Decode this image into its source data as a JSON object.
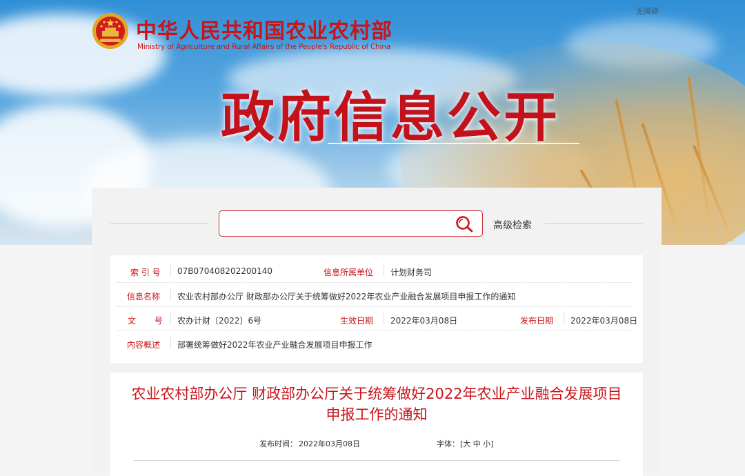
{
  "header": {
    "site_title_cn": "中华人民共和国农业农村部",
    "site_title_en": "Ministry of Agriculture and Rural Affairs of the People's Republic of China",
    "accessibility_label": "无障碍",
    "hero_title": "政府信息公开",
    "brand_red": "#c8141b"
  },
  "search": {
    "placeholder": "",
    "value": "",
    "advanced_label": "高级检索"
  },
  "info": {
    "index_label": "索 引 号",
    "index_value": "07B070408202200140",
    "unit_label": "信息所属单位",
    "unit_value": "计划财务司",
    "name_label": "信息名称",
    "name_value": "农业农村部办公厅 财政部办公厅关于统筹做好2022年农业产业融合发展项目申报工作的通知",
    "doc_label": "文       号",
    "doc_value": "农办计财〔2022〕6号",
    "effective_label": "生效日期",
    "effective_value": "2022年03月08日",
    "publish_label": "发布日期",
    "publish_value": "2022年03月08日",
    "summary_label": "内容概述",
    "summary_value": "部署统筹做好2022年农业产业融合发展项目申报工作"
  },
  "article": {
    "title": "农业农村部办公厅 财政部办公厅关于统筹做好2022年农业产业融合发展项目申报工作的通知",
    "publish_time_label": "发布时间：",
    "publish_time_value": "2022年03月08日",
    "font_size_label": "字体：",
    "font_size_options": "[大 中 小]"
  }
}
